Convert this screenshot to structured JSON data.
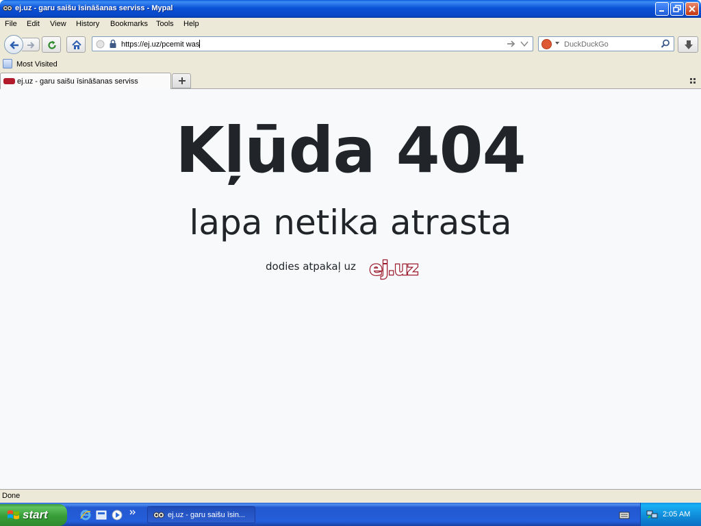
{
  "window": {
    "title": "ej.uz - garu saišu īsināšanas serviss - Mypal",
    "icon": "mypal-app-icon"
  },
  "menu": [
    "File",
    "Edit",
    "View",
    "History",
    "Bookmarks",
    "Tools",
    "Help"
  ],
  "navigation": {
    "url": "https://ej.uz/pcemit was",
    "search_placeholder": "DuckDuckGo",
    "search_engine": "duckduckgo-icon"
  },
  "bookmarks_bar": {
    "items": [
      {
        "label": "Most Visited"
      }
    ]
  },
  "tabs": [
    {
      "label": "ej.uz - garu saišu īsināšanas serviss",
      "active": true
    }
  ],
  "page": {
    "heading": "Kļūda 404",
    "subheading": "lapa netika atrasta",
    "back_text": "dodies atpakaļ uz",
    "logo_text": "ej.uz",
    "colors": {
      "text": "#212529",
      "background": "#f8f9fa",
      "logo": "#9b1b2d"
    }
  },
  "status": {
    "text": "Done"
  },
  "taskbar": {
    "start_label": "start",
    "task_label": "ej.uz - garu saišu īsin...",
    "clock": "2:05 AM"
  }
}
